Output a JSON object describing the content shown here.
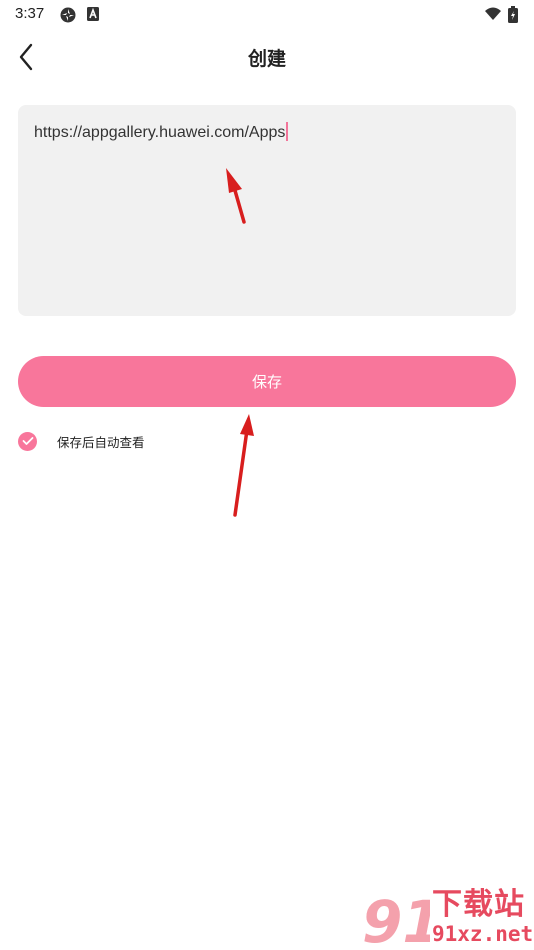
{
  "status_bar": {
    "time": "3:37",
    "left_icons": [
      "sync-icon",
      "a-box-icon"
    ],
    "right_icons": [
      "wifi-icon",
      "battery-icon"
    ]
  },
  "header": {
    "back_icon": "chevron-left-icon",
    "title": "创建"
  },
  "url_input": {
    "value": "https://appgallery.huawei.com/Apps"
  },
  "save_button": {
    "label": "保存"
  },
  "auto_view_option": {
    "checked": true,
    "label": "保存后自动查看"
  },
  "watermark": {
    "logo_text": "91",
    "text_cn": "下载站",
    "text_en": "91xz.net"
  },
  "colors": {
    "accent": "#f8769b",
    "annotation_arrow": "#d81e1e",
    "watermark": "#e64a5f"
  }
}
